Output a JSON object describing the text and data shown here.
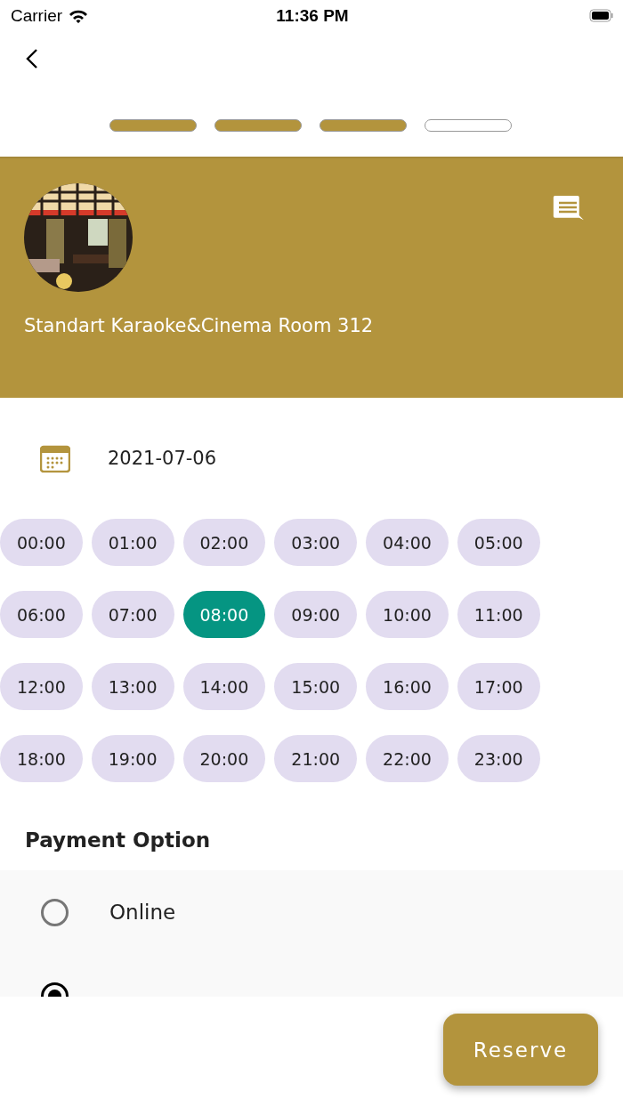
{
  "status_bar": {
    "carrier": "Carrier",
    "time": "11:36 PM"
  },
  "steps": [
    {
      "done": true
    },
    {
      "done": true
    },
    {
      "done": true
    },
    {
      "done": false
    }
  ],
  "header": {
    "title": "Standart Karaoke&Cinema Room 312"
  },
  "date": "2021-07-06",
  "time_slots": [
    {
      "label": "00:00",
      "selected": false
    },
    {
      "label": "01:00",
      "selected": false
    },
    {
      "label": "02:00",
      "selected": false
    },
    {
      "label": "03:00",
      "selected": false
    },
    {
      "label": "04:00",
      "selected": false
    },
    {
      "label": "05:00",
      "selected": false
    },
    {
      "label": "06:00",
      "selected": false
    },
    {
      "label": "07:00",
      "selected": false
    },
    {
      "label": "08:00",
      "selected": true
    },
    {
      "label": "09:00",
      "selected": false
    },
    {
      "label": "10:00",
      "selected": false
    },
    {
      "label": "11:00",
      "selected": false
    },
    {
      "label": "12:00",
      "selected": false
    },
    {
      "label": "13:00",
      "selected": false
    },
    {
      "label": "14:00",
      "selected": false
    },
    {
      "label": "15:00",
      "selected": false
    },
    {
      "label": "16:00",
      "selected": false
    },
    {
      "label": "17:00",
      "selected": false
    },
    {
      "label": "18:00",
      "selected": false
    },
    {
      "label": "19:00",
      "selected": false
    },
    {
      "label": "20:00",
      "selected": false
    },
    {
      "label": "21:00",
      "selected": false
    },
    {
      "label": "22:00",
      "selected": false
    },
    {
      "label": "23:00",
      "selected": false
    }
  ],
  "payment": {
    "title": "Payment Option",
    "options": [
      {
        "label": "Online",
        "selected": false
      },
      {
        "selected": true
      }
    ]
  },
  "button": "Reserve"
}
